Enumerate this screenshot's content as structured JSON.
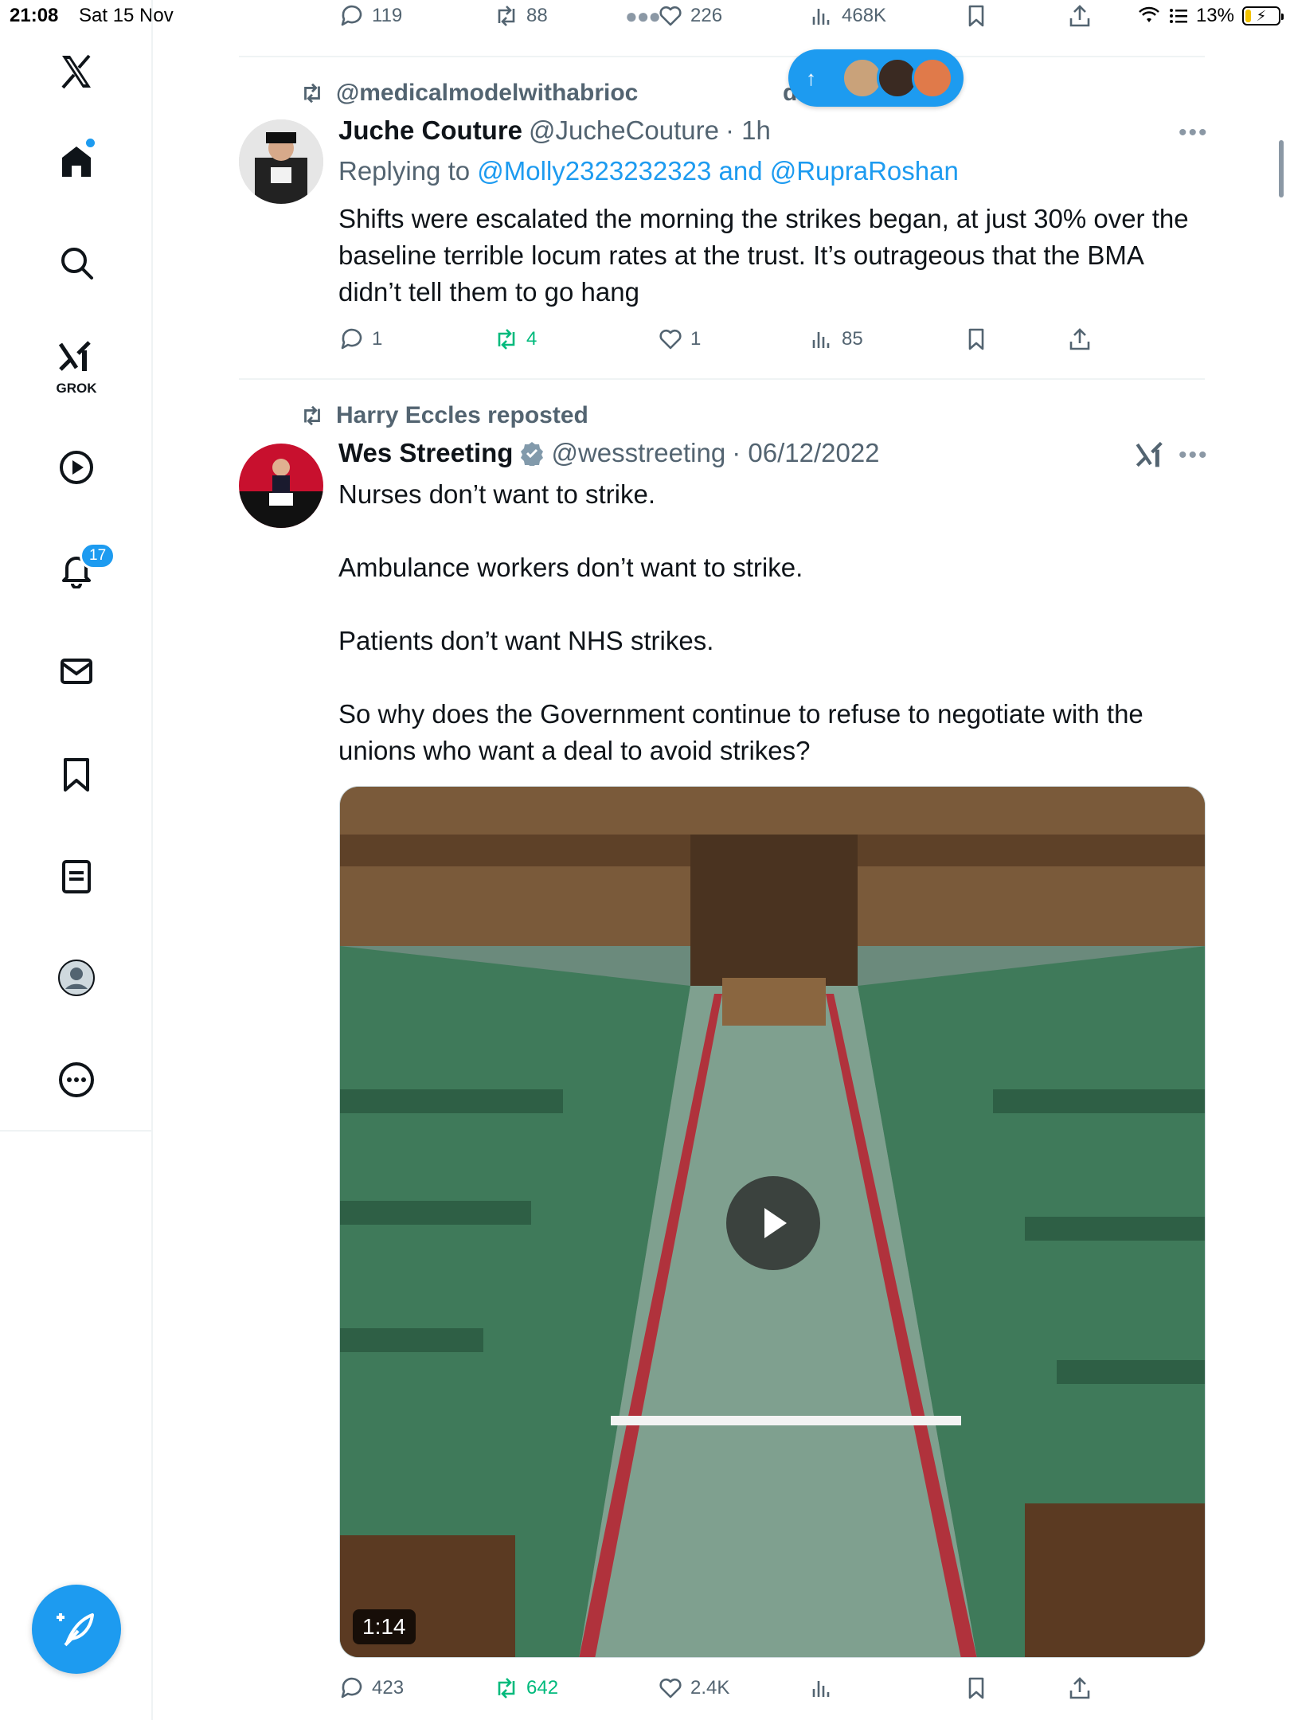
{
  "status_bar": {
    "time": "21:08",
    "date": "Sat 15 Nov",
    "battery": "13%"
  },
  "nav": {
    "grok_label": "GROK",
    "notifications_badge": "17"
  },
  "top_actions": {
    "replies": "119",
    "reposts": "88",
    "likes": "226",
    "views": "468K"
  },
  "tweet1": {
    "context": "@medicalmodelwithabrioc",
    "context_tail": "d",
    "name": "Juche Couture",
    "handle": "@JucheCouture",
    "time": "· 1h",
    "replying_prefix": "Replying to",
    "replying_to": "@Molly2323232323 and @RupraRoshan",
    "text": "Shifts were escalated the morning the strikes began, at just 30% over the baseline terrible locum rates at the trust. It’s outrageous that the BMA didn’t tell them to go hang",
    "replies": "1",
    "reposts": "4",
    "likes": "1",
    "views": "85"
  },
  "tweet2": {
    "context": "Harry Eccles reposted",
    "name": "Wes Streeting",
    "handle": "@wesstreeting",
    "time": "· 06/12/2022",
    "text": "Nurses don’t want to strike.\n\nAmbulance workers don’t want to strike.\n\nPatients don’t want NHS strikes.\n\nSo why does the Government continue to refuse to negotiate with the unions who want a deal to avoid strikes?",
    "video_duration": "1:14",
    "replies": "423",
    "reposts": "642",
    "likes": "2.4K",
    "views": ""
  },
  "colors": {
    "accent": "#1d9bf0",
    "repost_green": "#00ba7c",
    "secondary_text": "#536471"
  }
}
